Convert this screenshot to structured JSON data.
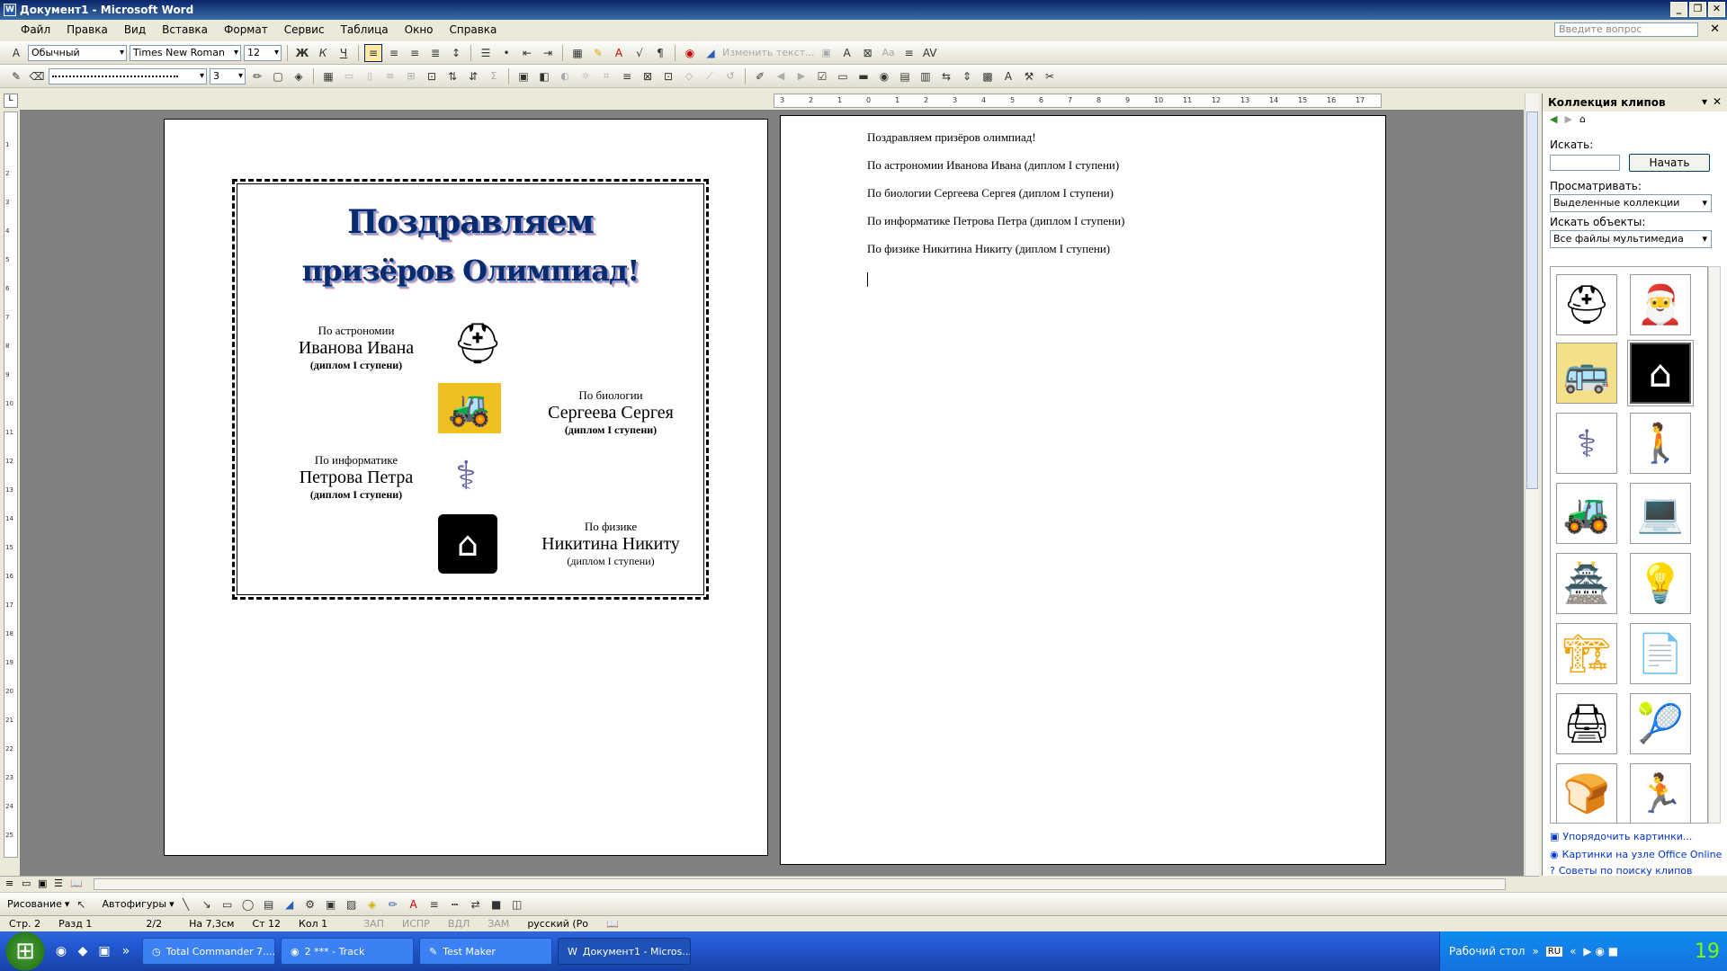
{
  "window": {
    "title": "Документ1 - Microsoft Word"
  },
  "menu": [
    "Файл",
    "Правка",
    "Вид",
    "Вставка",
    "Формат",
    "Сервис",
    "Таблица",
    "Окно",
    "Справка"
  ],
  "ask_placeholder": "Введите вопрос",
  "toolbar": {
    "style": "Обычный",
    "font": "Times New Roman",
    "size": "12",
    "bold": "Ж",
    "italic": "К",
    "underline": "Ч",
    "edit_text": "Изменить текст...",
    "line_width": "3"
  },
  "page1": {
    "wordart_line1": "Поздравляем",
    "wordart_line2": "призёров Олимпиад!",
    "awards": [
      {
        "subject": "По астрономии",
        "name": "Иванова Ивана",
        "diploma": "(диплом I ступени)"
      },
      {
        "subject": "По биологии",
        "name": "Сергеева Сергея",
        "diploma": "(диплом I ступени)"
      },
      {
        "subject": "По информатике",
        "name": "Петрова Петра",
        "diploma": "(диплом I ступени)"
      },
      {
        "subject": "По физике",
        "name": "Никитина Никиту",
        "diploma": "(диплом I ступени)"
      }
    ]
  },
  "page2": {
    "lines": [
      "Поздравляем призёров олимпиад!",
      "По астрономии Иванова Ивана (диплом I ступени)",
      "По биологии Сергеева Сергея (диплом I ступени)",
      "По информатике Петрова Петра (диплом I ступени)",
      "По физике Никитина Никиту (диплом I ступени)"
    ]
  },
  "pane": {
    "title": "Коллекция клипов",
    "search_label": "Искать:",
    "go_label": "Начать",
    "browse_label": "Просматривать:",
    "browse_value": "Выделенные коллекции",
    "objects_label": "Искать объекты:",
    "objects_value": "Все файлы мультимедиа",
    "links": [
      "Упорядочить картинки...",
      "Картинки на узле Office Online",
      "Советы по поиску клипов"
    ]
  },
  "drawbar": {
    "draw": "Рисование",
    "autoshapes": "Автофигуры"
  },
  "status": {
    "page": "Стр. 2",
    "section": "Разд 1",
    "pages": "2/2",
    "at": "На 7,3см",
    "line": "Ст 12",
    "col": "Кол 1",
    "rec": "ЗАП",
    "trk": "ИСПР",
    "ext": "ВДЛ",
    "ovr": "ЗАМ",
    "lang": "русский (Ро"
  },
  "taskbar": {
    "tasks": [
      "Total Commander 7....",
      "2 *** - Track",
      "Test Maker",
      "Документ1 - Micros..."
    ],
    "desktop": "Рабочий стол",
    "lang": "RU",
    "clock": "19"
  },
  "colors": {
    "wordart": "#0a2a6e",
    "link": "#0033cc",
    "titlebar": "#0a246a"
  }
}
